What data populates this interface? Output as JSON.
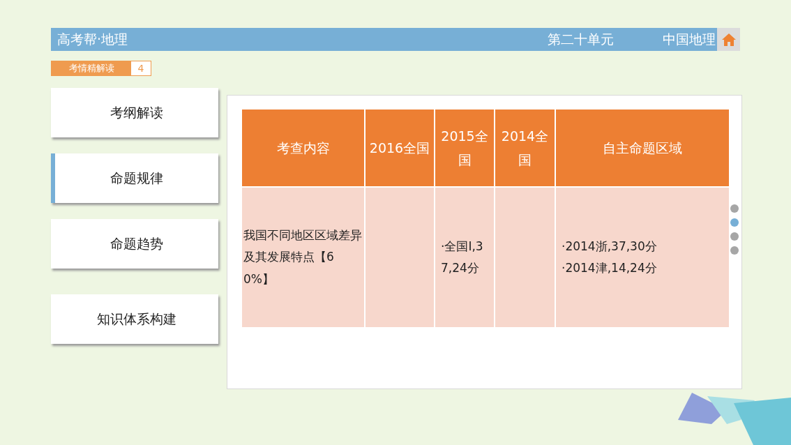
{
  "header": {
    "title": "高考帮·地理",
    "unit": "第二十单元",
    "subject": "中国地理"
  },
  "section_badge": {
    "label": "考情精解读",
    "page": "4"
  },
  "sidebar": {
    "items": [
      {
        "label": "考纲解读",
        "selected": false
      },
      {
        "label": "命题规律",
        "selected": true
      },
      {
        "label": "命题趋势",
        "selected": false
      },
      {
        "label": "知识体系构建",
        "selected": false
      }
    ]
  },
  "table": {
    "columns": [
      "考查内容",
      "2016全国",
      "2015全国",
      "2014全国",
      "自主命题区域"
    ],
    "rows": [
      {
        "cells": [
          [
            "我国不同地区区域差异及其发展特点【60%】"
          ],
          [],
          [
            "·全国Ⅰ,37,24分"
          ],
          [],
          [
            "·2014浙,37,30分",
            "·2014津,14,24分"
          ]
        ]
      }
    ]
  },
  "pager": [
    {
      "selected": false
    },
    {
      "selected": true
    },
    {
      "selected": false
    },
    {
      "selected": false
    }
  ]
}
